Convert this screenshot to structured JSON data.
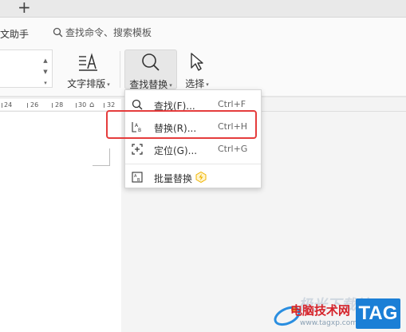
{
  "tabs": {
    "new_tab_glyph": "+"
  },
  "commands": {
    "assistant_label": "文助手",
    "search_placeholder": "查找命令、搜索模板"
  },
  "ribbon": {
    "typeset_label": "文字排版",
    "find_replace_label": "查找替换",
    "select_label": "选择",
    "caret": "▾"
  },
  "ruler": {
    "ticks": [
      "24",
      "26",
      "28",
      "30",
      "32"
    ]
  },
  "menu": {
    "items": [
      {
        "label": "查找(F)...",
        "shortcut": "Ctrl+F",
        "icon": "search-icon"
      },
      {
        "label": "替换(R)...",
        "shortcut": "Ctrl+H",
        "icon": "replace-icon"
      },
      {
        "label": "定位(G)...",
        "shortcut": "Ctrl+G",
        "icon": "goto-icon"
      },
      {
        "label": "批量替换",
        "shortcut": "",
        "icon": "batch-replace-icon"
      }
    ]
  },
  "watermark": {
    "line1": "极光下载站",
    "line2": "电脑技术网",
    "line3": "www.tagxp.com",
    "tag": "TAG"
  },
  "colors": {
    "highlight": "#e53c3c",
    "accent": "#1b7fd6",
    "premium_bolt": "#f0b400"
  }
}
